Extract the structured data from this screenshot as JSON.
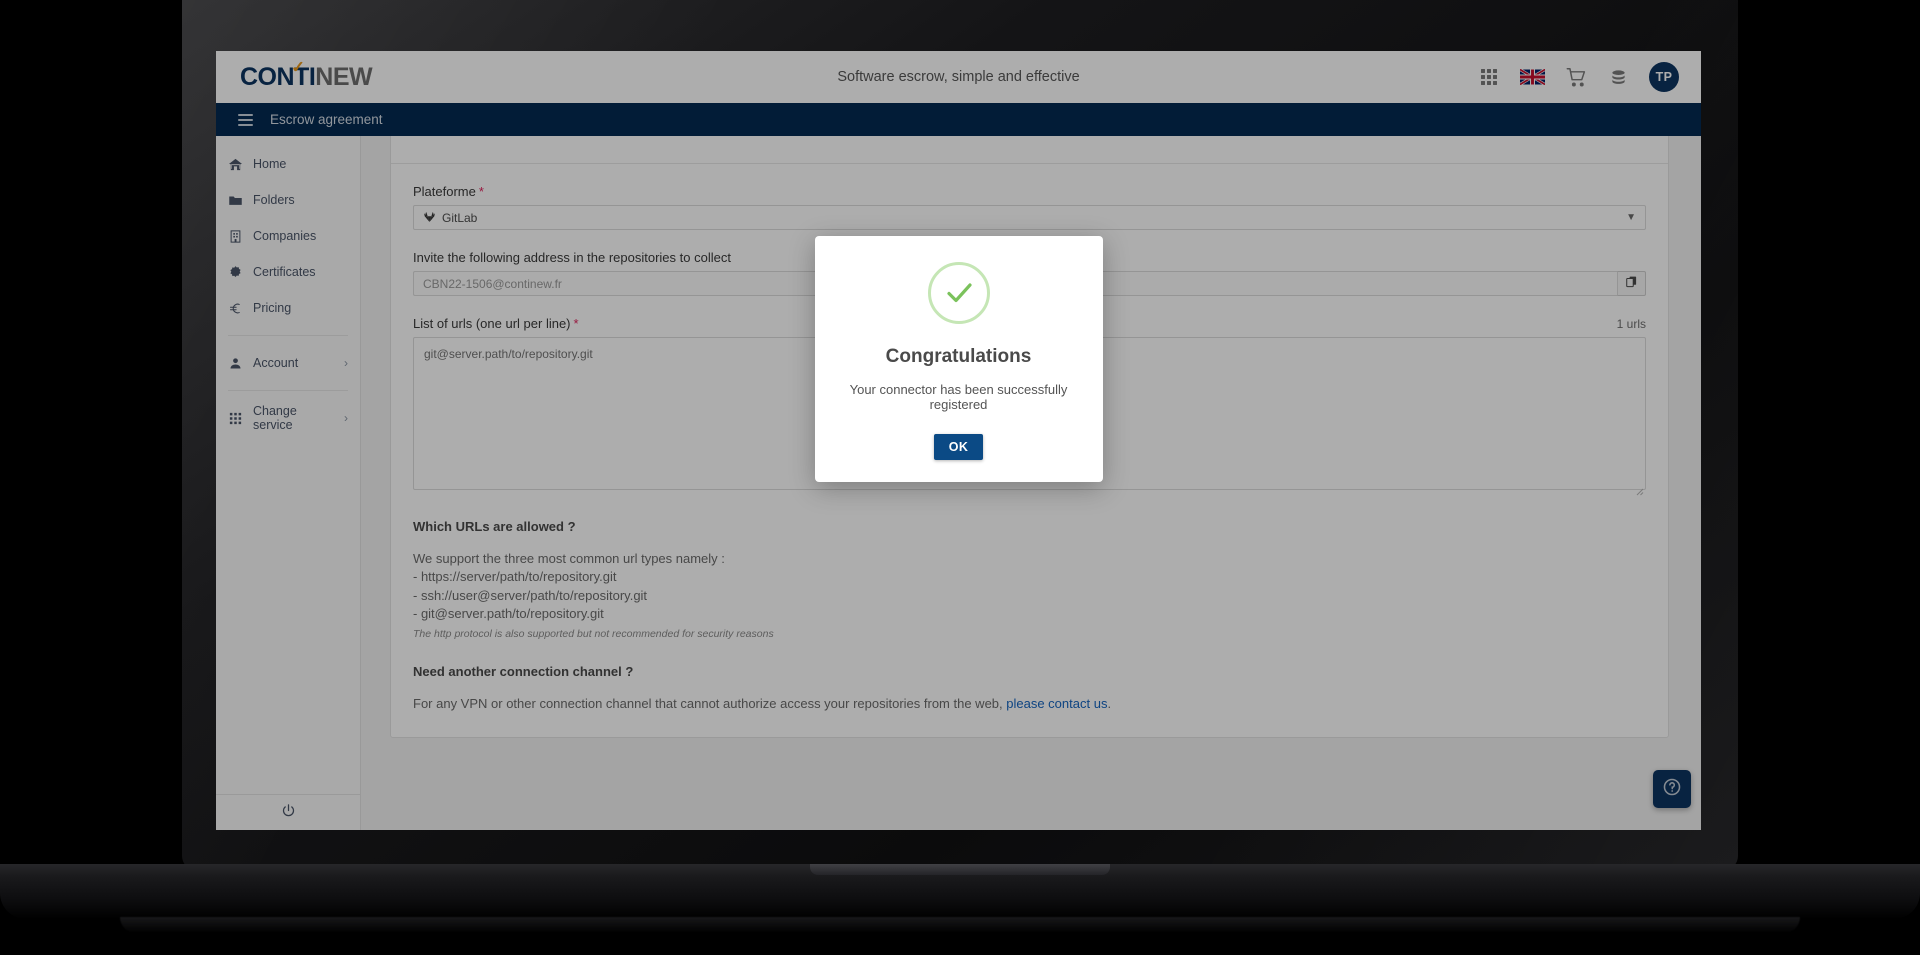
{
  "brand": {
    "logo_part1": "CONTI",
    "logo_part2": "NEW",
    "logo_check": "✓"
  },
  "header": {
    "tagline": "Software escrow, simple and effective",
    "avatar_initials": "TP",
    "icons": [
      "apps-grid-icon",
      "uk-flag-icon",
      "cart-icon",
      "coins-icon"
    ]
  },
  "subbar": {
    "title": "Escrow agreement",
    "menu_icon": "hamburger-menu-icon"
  },
  "sidebar": {
    "items": [
      {
        "label": "Home",
        "icon": "home-icon",
        "chevron": ""
      },
      {
        "label": "Folders",
        "icon": "folder-icon",
        "chevron": ""
      },
      {
        "label": "Companies",
        "icon": "building-icon",
        "chevron": ""
      },
      {
        "label": "Certificates",
        "icon": "certificate-icon",
        "chevron": ""
      },
      {
        "label": "Pricing",
        "icon": "euro-icon",
        "chevron": ""
      },
      {
        "label": "Account",
        "icon": "person-icon",
        "chevron": "›"
      },
      {
        "label": "Change service",
        "icon": "grid-icon",
        "chevron": "›"
      }
    ],
    "logout_icon": "power-icon"
  },
  "form": {
    "platform_label": "Plateforme",
    "platform_required": "*",
    "platform_value": "GitLab",
    "platform_icon": "gitlab-fox-icon",
    "invite_label": "Invite the following address in the repositories to collect",
    "invite_value": "CBN22-1506@continew.fr",
    "copy_icon": "copy-icon",
    "urls_label": "List of urls (one url per line)",
    "urls_required": "*",
    "urls_count": "1 urls",
    "urls_placeholder": "git@server.path/to/repository.git",
    "urls_value": ""
  },
  "help": {
    "urls_heading": "Which URLs are allowed ?",
    "urls_intro": "We support the three most common url types namely :",
    "url_types": [
      "- https://server/path/to/repository.git",
      "- ssh://user@server/path/to/repository.git",
      "- git@server.path/to/repository.git"
    ],
    "http_note": "The http protocol is also supported but not recommended for security reasons",
    "channel_heading": "Need another connection channel ?",
    "channel_text_before": "For any VPN or other connection channel that cannot authorize access your repositories from the web, ",
    "channel_link": "please contact us",
    "channel_text_after": "."
  },
  "fab": {
    "icon": "help-question-icon"
  },
  "modal": {
    "icon": "success-check-icon",
    "title": "Congratulations",
    "message": "Your connector has been successfully registered",
    "ok_label": "OK"
  },
  "colors": {
    "brand_dark_blue": "#0d3461",
    "subbar_blue": "#032a52",
    "accent_orange": "#eb9a1c",
    "required_red": "#e0245e",
    "link_blue": "#1565c0",
    "success_green": "#7bc25c",
    "button_blue": "#0b4a85"
  }
}
